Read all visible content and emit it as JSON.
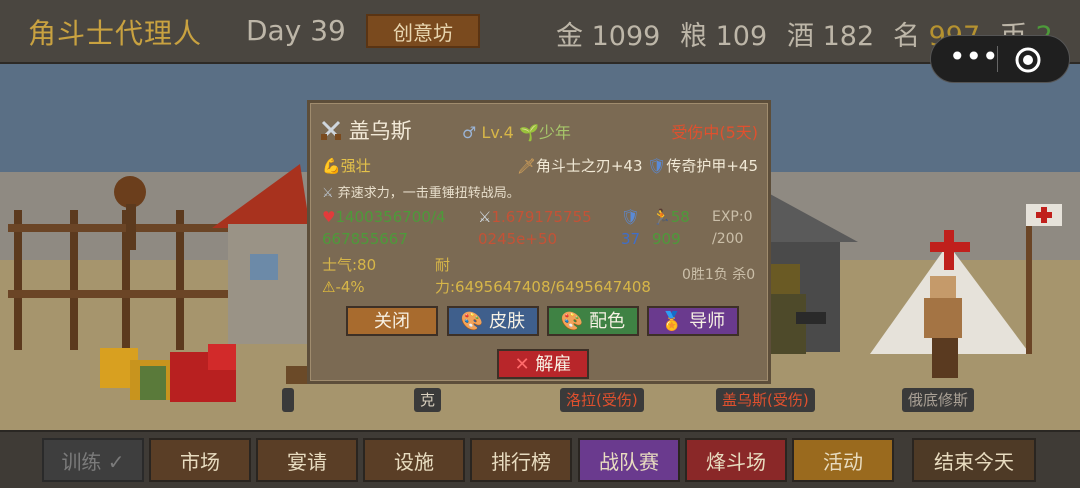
{
  "topbar": {
    "title": "角斗士代理人",
    "day": "Day 39",
    "workshop_label": "创意坊",
    "gold_label": "金",
    "gold_value": "1099",
    "food_label": "粮",
    "food_value": "109",
    "wine_label": "酒",
    "wine_value": "182",
    "fame_label": "名",
    "fame_value": "997",
    "coin_label": "币",
    "coin_value": "2",
    "capsule": {
      "more_icon": "ellipsis-icon",
      "close_icon": "target-icon"
    }
  },
  "scene": {
    "floor_names": [
      {
        "text": "",
        "color": "#d9d0bf"
      },
      {
        "text": "克",
        "color": "#d9d0bf"
      },
      {
        "text": "洛拉(受伤)",
        "color": "#e0502e"
      },
      {
        "text": "盖乌斯(受伤)",
        "color": "#e0502e"
      },
      {
        "text": "俄底修斯",
        "color": "#a9a095"
      }
    ]
  },
  "modal": {
    "name": "盖乌斯",
    "gender_icon": "male-icon",
    "level": "Lv.4",
    "age": "少年",
    "status": "受伤中(5天)",
    "trait": "强壮",
    "weapon": "角斗士之刃+43",
    "armor": "传奇护甲+45",
    "description": "弃速求力，一击重锤扭转战局。",
    "hp": "1400356700/4",
    "hp2": "667855667",
    "attack": "1.679175755",
    "attack2": "0245e+50",
    "defense": "37",
    "speed": "58",
    "speed2": "909",
    "exp_label": "EXP:0",
    "exp_max": "/200",
    "morale": "士气:80",
    "warning": "-4%",
    "stamina_label": "耐",
    "stamina": "力:6495647408/6495647408",
    "record": "0胜1负 杀0",
    "buttons": {
      "close": "关闭",
      "skin": "皮肤",
      "color": "配色",
      "mentor": "导师",
      "dismiss": "解雇"
    }
  },
  "bottombar": {
    "train": "训练 ✓",
    "market": "市场",
    "feast": "宴请",
    "facilities": "设施",
    "ranking": "排行榜",
    "team_battle": "战队赛",
    "arena": "烽斗场",
    "event": "活动",
    "end_day": "结束今天"
  },
  "colors": {
    "accent_gold": "#c9a240",
    "danger": "#e0502e",
    "hp_red": "#e23b3b",
    "ok_green": "#4d9a3a",
    "def_blue": "#3f6ec9"
  }
}
